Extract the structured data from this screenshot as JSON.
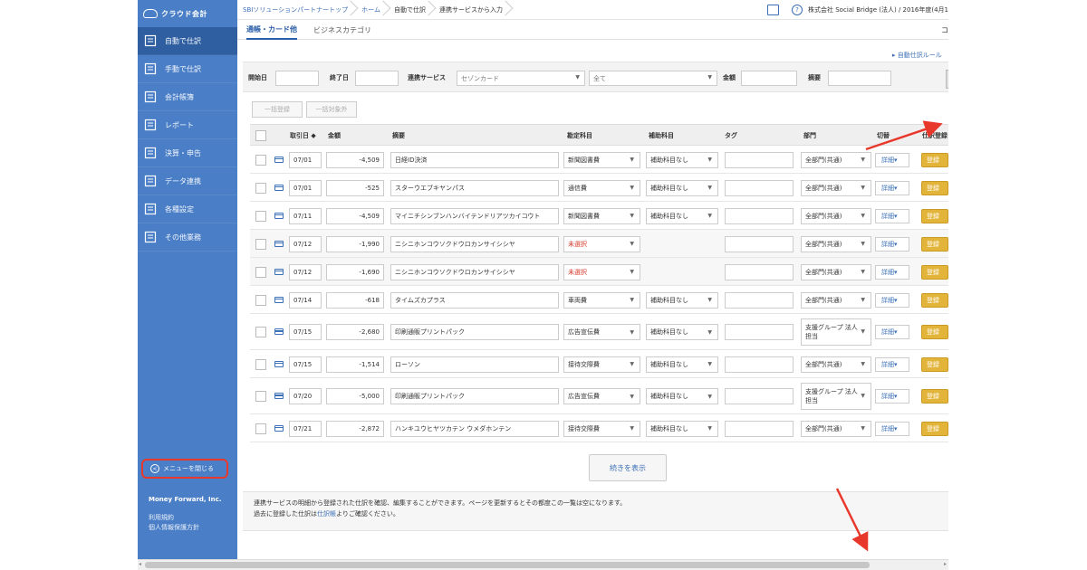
{
  "sidebar": {
    "logo_text": "クラウド会計",
    "items": [
      {
        "label": "自動で仕訳",
        "icon": "auto-journal-icon",
        "active": true
      },
      {
        "label": "手動で仕訳",
        "icon": "manual-journal-icon",
        "active": false
      },
      {
        "label": "会計帳簿",
        "icon": "ledger-icon",
        "active": false
      },
      {
        "label": "レポート",
        "icon": "report-chart-icon",
        "active": false
      },
      {
        "label": "決算・申告",
        "icon": "settlement-icon",
        "active": false
      },
      {
        "label": "データ連携",
        "icon": "data-link-icon",
        "active": false
      },
      {
        "label": "各種設定",
        "icon": "gear-icon",
        "active": false
      },
      {
        "label": "その他業務",
        "icon": "list-icon",
        "active": false
      }
    ],
    "collapse_label": "メニューを閉じる",
    "company": "Money Forward, Inc.",
    "links": [
      "利用規約",
      "個人情報保護方針"
    ]
  },
  "topbar": {
    "breadcrumbs": [
      "SBIソリューションパートナートップ",
      "ホーム",
      "自動で仕訳",
      "連携サービスから入力"
    ],
    "company_text": "株式会社 Social Bridge (法人) / 2016年度(4月1"
  },
  "tabs": [
    {
      "label": "通帳・カード他",
      "active": true
    },
    {
      "label": "ビジネスカテゴリ",
      "active": false
    }
  ],
  "tabs_more": "コ",
  "rule_link": "▸ 自動仕訳ルール",
  "filter": {
    "start_label": "開始日",
    "end_label": "終了日",
    "service_label": "連携サービス",
    "service_value": "セゾンカード",
    "type_value": "全て",
    "amount_label": "金額",
    "memo_label": "摘要"
  },
  "bulk": {
    "register": "一括登録",
    "exclude": "一括対象外"
  },
  "table": {
    "headers": {
      "date": "取引日 ◆",
      "amount": "金額",
      "memo": "摘要",
      "account": "勘定科目",
      "sub_account": "補助科目",
      "tag": "タグ",
      "department": "部門",
      "tax": "切替",
      "register": "仕訳登録"
    },
    "rows": [
      {
        "date": "07/01",
        "amount": "-4,509",
        "memo": "日経ID決済",
        "account": "新聞図書費",
        "sub": "補助科目なし",
        "dept": "全部門(共通)",
        "detail": "詳細",
        "reg": "登録"
      },
      {
        "date": "07/01",
        "amount": "-525",
        "memo": "スターウエブキヤンパス",
        "account": "通信費",
        "sub": "補助科目なし",
        "dept": "全部門(共通)",
        "detail": "詳細",
        "reg": "登録"
      },
      {
        "date": "07/11",
        "amount": "-4,509",
        "memo": "マイニチシンブンハンバイテンドリアツカイコウト",
        "account": "新聞図書費",
        "sub": "補助科目なし",
        "dept": "全部門(共通)",
        "detail": "詳細",
        "reg": "登録"
      },
      {
        "date": "07/12",
        "amount": "-1,990",
        "memo": "ニシニホンコウソクドウロカンサイシシヤ",
        "account": "未選択",
        "sub": "",
        "dept": "全部門(共通)",
        "detail": "詳細",
        "reg": "登録"
      },
      {
        "date": "07/12",
        "amount": "-1,690",
        "memo": "ニシニホンコウソクドウロカンサイシシヤ",
        "account": "未選択",
        "sub": "",
        "dept": "全部門(共通)",
        "detail": "詳細",
        "reg": "登録"
      },
      {
        "date": "07/14",
        "amount": "-618",
        "memo": "タイムズカプラス",
        "account": "車両費",
        "sub": "補助科目なし",
        "dept": "全部門(共通)",
        "detail": "詳細",
        "reg": "登録"
      },
      {
        "date": "07/15",
        "amount": "-2,680",
        "memo": "印刷通販プリントパック",
        "account": "広告宣伝費",
        "sub": "補助科目なし",
        "dept": "支援グループ 法人担当",
        "detail": "詳細",
        "reg": "登録"
      },
      {
        "date": "07/15",
        "amount": "-1,514",
        "memo": "ローソン",
        "account": "接待交際費",
        "sub": "補助科目なし",
        "dept": "全部門(共通)",
        "detail": "詳細",
        "reg": "登録"
      },
      {
        "date": "07/20",
        "amount": "-5,000",
        "memo": "印刷通販プリントパック",
        "account": "広告宣伝費",
        "sub": "補助科目なし",
        "dept": "支援グループ 法人担当",
        "detail": "詳細",
        "reg": "登録"
      },
      {
        "date": "07/21",
        "amount": "-2,872",
        "memo": "ハンキユウヒヤツカテン ウメダホンテン",
        "account": "接待交際費",
        "sub": "補助科目なし",
        "dept": "全部門(共通)",
        "detail": "詳細",
        "reg": "登録"
      }
    ]
  },
  "more_button": "続きを表示",
  "notes": {
    "line1": "連携サービスの明細から登録された仕訳を確認、編集することができます。ページを更新するとその都度この一覧は空になります。",
    "line2_pre": "過去に登録した仕訳は",
    "line2_link": "仕訳帳",
    "line2_post": "よりご確認ください。"
  },
  "colors": {
    "sidebar": "#4a7fc7",
    "sidebar_active": "#2f5fa0",
    "accent": "#3b6fb6",
    "register": "#e2b43a",
    "annotation": "#e8382b",
    "unselected": "#d83a2a"
  }
}
